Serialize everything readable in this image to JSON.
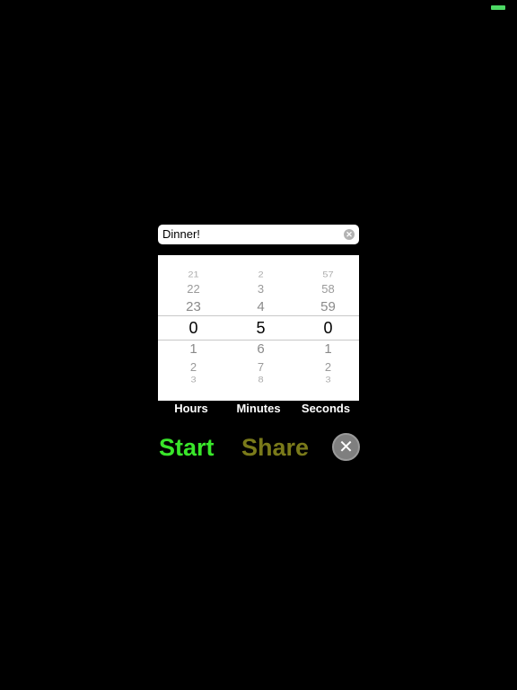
{
  "status_bar": {
    "battery_color": "#4cd964"
  },
  "timer_name": {
    "value": "Dinner!",
    "clear_icon": "clear-circle-icon"
  },
  "picker": {
    "hours": [
      "",
      "21",
      "22",
      "23",
      "0",
      "1",
      "2",
      "3",
      ""
    ],
    "minutes": [
      "",
      "2",
      "3",
      "4",
      "5",
      "6",
      "7",
      "8",
      ""
    ],
    "seconds": [
      "",
      "57",
      "58",
      "59",
      "0",
      "1",
      "2",
      "3",
      ""
    ],
    "selected": {
      "hours": "0",
      "minutes": "5",
      "seconds": "0"
    }
  },
  "labels": {
    "hours": "Hours",
    "minutes": "Minutes",
    "seconds": "Seconds"
  },
  "actions": {
    "start": "Start",
    "share": "Share",
    "close_icon": "close-x-icon",
    "start_color": "#39e62a",
    "share_color": "#7a7a1a"
  }
}
